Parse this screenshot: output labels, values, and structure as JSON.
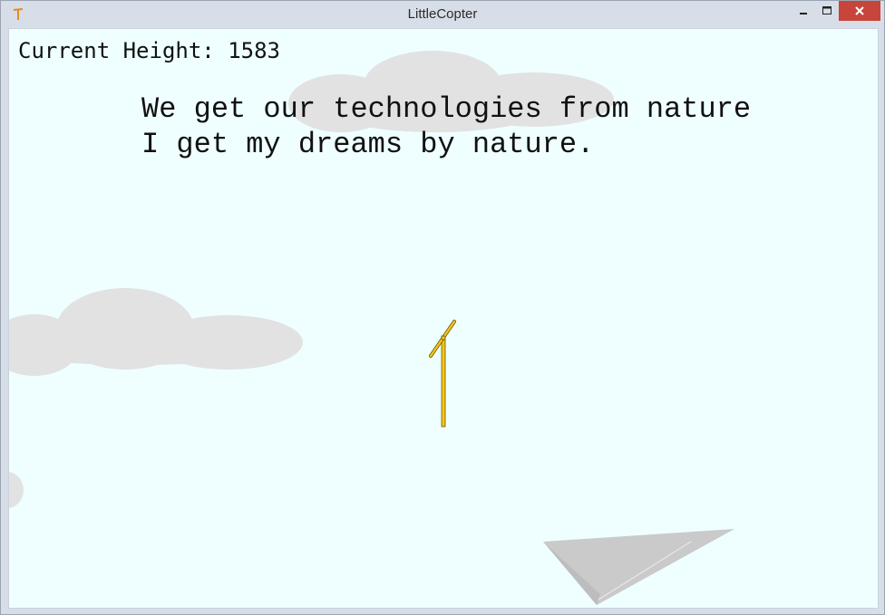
{
  "window": {
    "title": "LittleCopter",
    "app_icon": "copter-app-icon",
    "controls": [
      "minimize-icon",
      "maximize-icon",
      "close-icon"
    ]
  },
  "hud": {
    "height_label": "Current Height:",
    "height_value": "1583"
  },
  "quote": {
    "line1": "We get our technologies from nature",
    "line2": "I get my dreams by nature."
  },
  "colors": {
    "sky": "#efffff",
    "cloud": "#e2e2e2",
    "copter_body": "#f5c518",
    "copter_outline": "#6b5a00",
    "paper_plane": "#c9c9c9",
    "close_button": "#c7453a"
  }
}
